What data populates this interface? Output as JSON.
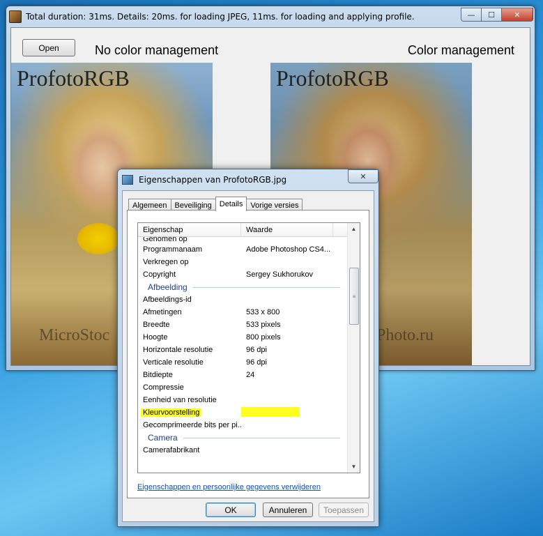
{
  "main_window": {
    "title": "Total duration: 31ms. Details: 20ms. for loading JPEG, 11ms. for loading and applying profile.",
    "caption": {
      "minimize": "—",
      "maximize": "☐",
      "close": "✕"
    },
    "open_button": "Open",
    "left_label": "No color management",
    "right_label": "Color management",
    "left_image": {
      "title_text": "ProfotoRGB",
      "watermark": "MicroStoc"
    },
    "right_image": {
      "title_text": "ProfotoRGB",
      "watermark": "kPhoto.ru"
    }
  },
  "dialog": {
    "title": "Eigenschappen van ProfotoRGB.jpg",
    "close": "✕",
    "tabs": [
      {
        "label": "Algemeen",
        "active": false
      },
      {
        "label": "Beveiliging",
        "active": false
      },
      {
        "label": "Details",
        "active": true
      },
      {
        "label": "Vorige versies",
        "active": false
      }
    ],
    "columns": {
      "property": "Eigenschap",
      "value": "Waarde"
    },
    "rows": [
      {
        "key": "Genomen op",
        "value": ""
      },
      {
        "key": "Programmanaam",
        "value": "Adobe Photoshop CS4..."
      },
      {
        "key": "Verkregen op",
        "value": ""
      },
      {
        "key": "Copyright",
        "value": "Sergey Sukhorukov"
      },
      {
        "group": "Afbeelding"
      },
      {
        "key": "Afbeeldings-id",
        "value": ""
      },
      {
        "key": "Afmetingen",
        "value": "533 x 800"
      },
      {
        "key": "Breedte",
        "value": "533 pixels"
      },
      {
        "key": "Hoogte",
        "value": "800 pixels"
      },
      {
        "key": "Horizontale resolutie",
        "value": "96 dpi"
      },
      {
        "key": "Verticale resolutie",
        "value": "96 dpi"
      },
      {
        "key": "Bitdiepte",
        "value": "24"
      },
      {
        "key": "Compressie",
        "value": ""
      },
      {
        "key": "Eenheid van resolutie",
        "value": ""
      },
      {
        "key": "Kleurvoorstelling",
        "value": ""
      },
      {
        "key": "Gecomprimeerde bits per pi...",
        "value": ""
      },
      {
        "group": "Camera"
      },
      {
        "key": "Camerafabrikant",
        "value": ""
      }
    ],
    "highlight_color": "#ffff22",
    "remove_link": "Eigenschappen en persoonlijke gegevens verwijderen",
    "buttons": {
      "ok": "OK",
      "cancel": "Annuleren",
      "apply": "Toepassen"
    }
  }
}
